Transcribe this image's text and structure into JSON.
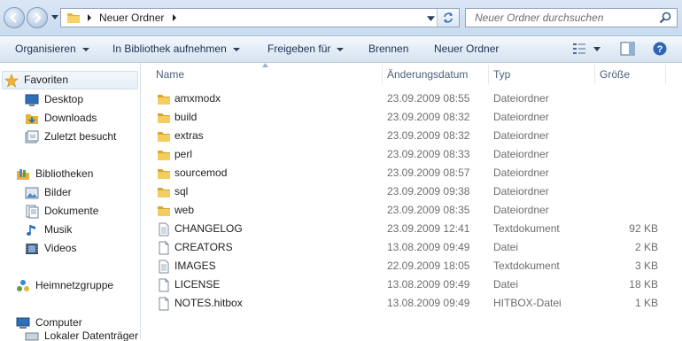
{
  "address": {
    "crumb": "Neuer Ordner"
  },
  "search": {
    "placeholder": "Neuer Ordner durchsuchen"
  },
  "toolbar": {
    "organize": "Organisieren",
    "include_library": "In Bibliothek aufnehmen",
    "share": "Freigeben für",
    "burn": "Brennen",
    "new_folder": "Neuer Ordner"
  },
  "nav": {
    "favorites": "Favoriten",
    "desktop": "Desktop",
    "downloads": "Downloads",
    "recent": "Zuletzt besucht",
    "libraries": "Bibliotheken",
    "pictures": "Bilder",
    "documents": "Dokumente",
    "music": "Musik",
    "videos": "Videos",
    "homegroup": "Heimnetzgruppe",
    "computer": "Computer",
    "local_disk": "Lokaler Datenträger"
  },
  "columns": {
    "name": "Name",
    "date": "Änderungsdatum",
    "type": "Typ",
    "size": "Größe"
  },
  "files": [
    {
      "name": "amxmodx",
      "date": "23.09.2009 08:55",
      "type": "Dateiordner",
      "size": "",
      "icon": "folder-icon"
    },
    {
      "name": "build",
      "date": "23.09.2009 08:32",
      "type": "Dateiordner",
      "size": "",
      "icon": "folder-icon"
    },
    {
      "name": "extras",
      "date": "23.09.2009 08:32",
      "type": "Dateiordner",
      "size": "",
      "icon": "folder-icon"
    },
    {
      "name": "perl",
      "date": "23.09.2009 08:33",
      "type": "Dateiordner",
      "size": "",
      "icon": "folder-icon"
    },
    {
      "name": "sourcemod",
      "date": "23.09.2009 08:57",
      "type": "Dateiordner",
      "size": "",
      "icon": "folder-icon"
    },
    {
      "name": "sql",
      "date": "23.09.2009 09:38",
      "type": "Dateiordner",
      "size": "",
      "icon": "folder-icon"
    },
    {
      "name": "web",
      "date": "23.09.2009 08:35",
      "type": "Dateiordner",
      "size": "",
      "icon": "folder-icon"
    },
    {
      "name": "CHANGELOG",
      "date": "23.09.2009 12:41",
      "type": "Textdokument",
      "size": "92 KB",
      "icon": "text-document-icon"
    },
    {
      "name": "CREATORS",
      "date": "13.08.2009 09:49",
      "type": "Datei",
      "size": "2 KB",
      "icon": "file-icon"
    },
    {
      "name": "IMAGES",
      "date": "22.09.2009 18:05",
      "type": "Textdokument",
      "size": "3 KB",
      "icon": "text-document-icon"
    },
    {
      "name": "LICENSE",
      "date": "13.08.2009 09:49",
      "type": "Datei",
      "size": "18 KB",
      "icon": "file-icon"
    },
    {
      "name": "NOTES.hitbox",
      "date": "13.08.2009 09:49",
      "type": "HITBOX-Datei",
      "size": "1 KB",
      "icon": "file-icon"
    }
  ],
  "colors": {
    "folder": "#f1c24a",
    "link": "#1e3250",
    "secondary_text": "#6d6d6d"
  }
}
